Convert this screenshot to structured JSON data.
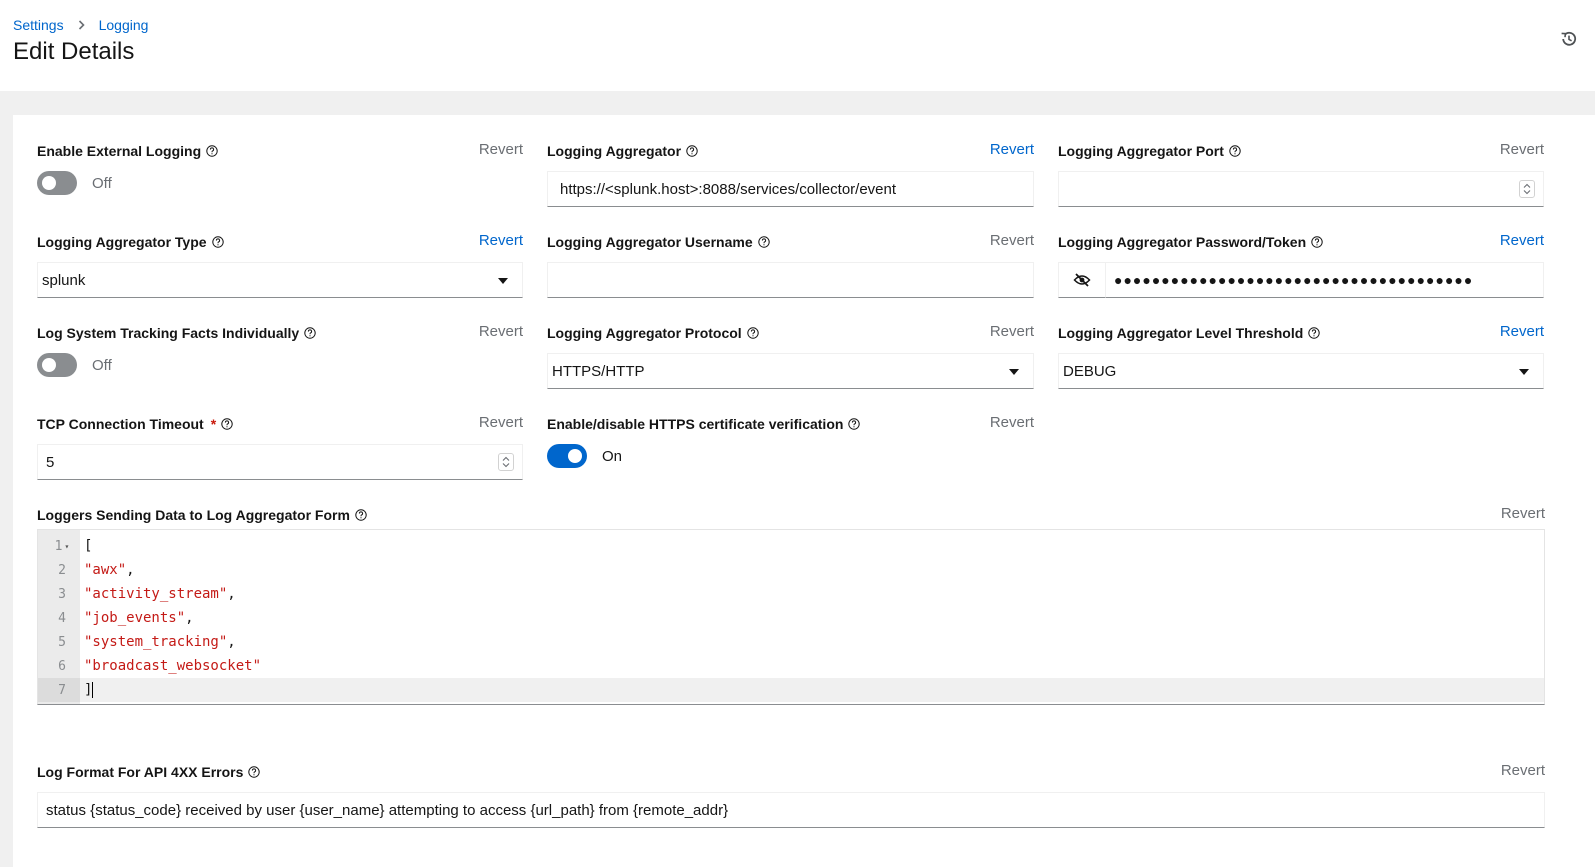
{
  "breadcrumb": {
    "items": [
      "Settings",
      "Logging"
    ]
  },
  "header": {
    "title": "Edit Details"
  },
  "icons": {
    "history": "history-icon",
    "help": "question-circle-icon",
    "eye": "eye-slash-icon",
    "caret": "caret-down-icon"
  },
  "colors": {
    "link": "#0066cc",
    "required": "#c9190b",
    "toggle_on": "#0066cc",
    "toggle_off": "#8a8d90",
    "string": "#c41a16"
  },
  "fields": {
    "enable_external_logging": {
      "label": "Enable External Logging",
      "revert": "Revert",
      "state": "Off"
    },
    "logging_aggregator": {
      "label": "Logging Aggregator",
      "revert": "Revert",
      "value": "https://<splunk.host>:8088/services/collector/event"
    },
    "logging_aggregator_port": {
      "label": "Logging Aggregator Port",
      "revert": "Revert",
      "value": ""
    },
    "logging_aggregator_type": {
      "label": "Logging Aggregator Type",
      "revert": "Revert",
      "value": "splunk"
    },
    "logging_aggregator_username": {
      "label": "Logging Aggregator Username",
      "revert": "Revert",
      "value": ""
    },
    "logging_aggregator_password": {
      "label": "Logging Aggregator Password/Token",
      "revert": "Revert",
      "value": "●●●●●●●●●●●●●●●●●●●●●●●●●●●●●●●●●●●●●●"
    },
    "log_system_tracking_facts": {
      "label": "Log System Tracking Facts Individually",
      "revert": "Revert",
      "state": "Off"
    },
    "logging_aggregator_protocol": {
      "label": "Logging Aggregator Protocol",
      "revert": "Revert",
      "value": "HTTPS/HTTP"
    },
    "logging_aggregator_level": {
      "label": "Logging Aggregator Level Threshold",
      "revert": "Revert",
      "value": "DEBUG"
    },
    "tcp_timeout": {
      "label": "TCP Connection Timeout",
      "required_mark": "*",
      "revert": "Revert",
      "value": "5"
    },
    "https_verify": {
      "label": "Enable/disable HTTPS certificate verification",
      "revert": "Revert",
      "state": "On"
    },
    "loggers": {
      "label": "Loggers Sending Data to Log Aggregator Form",
      "revert": "Revert",
      "lines": [
        {
          "num": "1",
          "open": "["
        },
        {
          "num": "2",
          "str": "\"awx\"",
          "tail": ","
        },
        {
          "num": "3",
          "str": "\"activity_stream\"",
          "tail": ","
        },
        {
          "num": "4",
          "str": "\"job_events\"",
          "tail": ","
        },
        {
          "num": "5",
          "str": "\"system_tracking\"",
          "tail": ","
        },
        {
          "num": "6",
          "str": "\"broadcast_websocket\"",
          "tail": ""
        },
        {
          "num": "7",
          "close": "]"
        }
      ]
    },
    "log_format_4xx": {
      "label": "Log Format For API 4XX Errors",
      "revert": "Revert",
      "value": "status {status_code} received by user {user_name} attempting to access {url_path} from {remote_addr}"
    }
  }
}
